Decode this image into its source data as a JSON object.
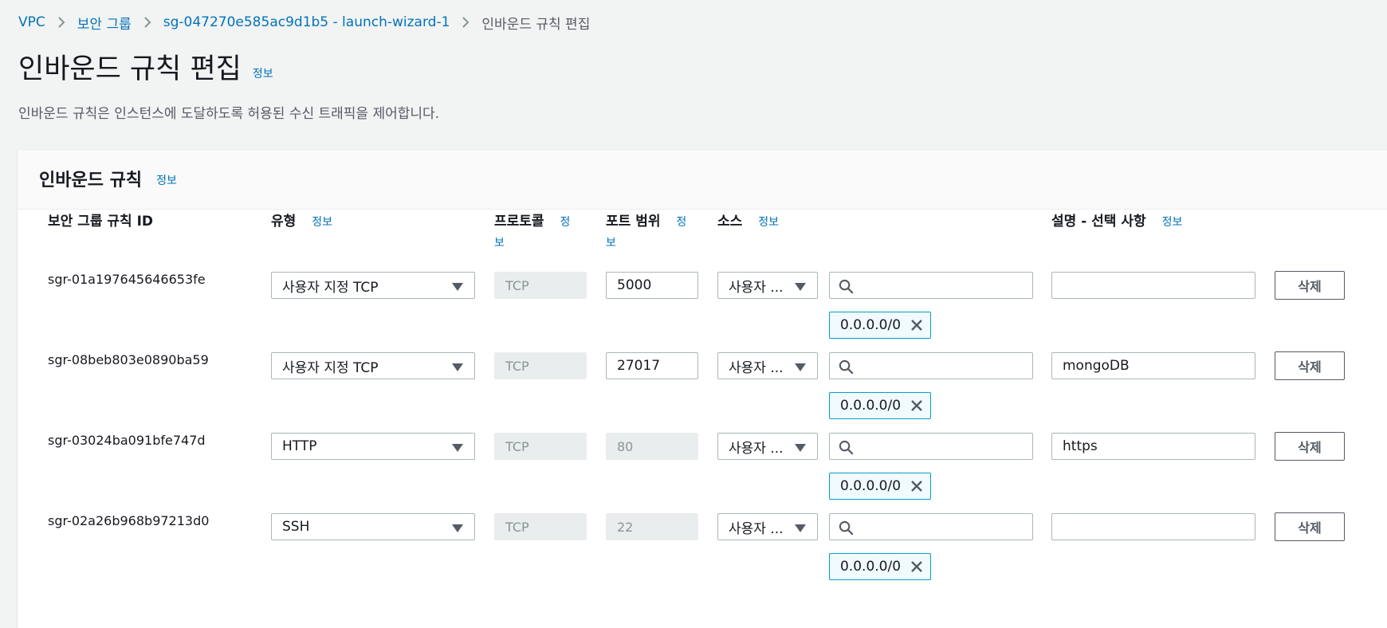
{
  "breadcrumb": {
    "items": [
      "VPC",
      "보안 그룹",
      "sg-047270e585ac9d1b5 - launch-wizard-1"
    ],
    "current": "인바운드 규칙 편집"
  },
  "page": {
    "title": "인바운드 규칙 편집",
    "info": "정보",
    "description": "인바운드 규칙은 인스턴스에 도달하도록 허용된 수신 트래픽을 제어합니다."
  },
  "panel": {
    "title": "인바운드 규칙",
    "info": "정보",
    "columns": {
      "id": "보안 그룹 규칙 ID",
      "type": "유형",
      "protocol": "프로토콜",
      "port": "포트 범위",
      "source": "소스",
      "desc": "설명 - 선택 사항"
    },
    "col_info": "정보",
    "protocol_info_line1": "정",
    "protocol_info_line2": "보",
    "port_info_line1": "정",
    "port_info_line2": "보"
  },
  "rules": [
    {
      "id": "sgr-01a197645646653fe",
      "type": "사용자 지정 TCP",
      "protocol": "TCP",
      "port": "5000",
      "source": "사용자 ...",
      "cidr": "0.0.0.0/0",
      "description": "",
      "delete": "삭제"
    },
    {
      "id": "sgr-08beb803e0890ba59",
      "type": "사용자 지정 TCP",
      "protocol": "TCP",
      "port": "27017",
      "source": "사용자 ...",
      "cidr": "0.0.0.0/0",
      "description": "mongoDB",
      "delete": "삭제"
    },
    {
      "id": "sgr-03024ba091bfe747d",
      "type": "HTTP",
      "protocol": "TCP",
      "port": "80",
      "source": "사용자 ...",
      "cidr": "0.0.0.0/0",
      "description": "https",
      "delete": "삭제"
    },
    {
      "id": "sgr-02a26b968b97213d0",
      "type": "SSH",
      "protocol": "TCP",
      "port": "22",
      "source": "사용자 ...",
      "cidr": "0.0.0.0/0",
      "description": "",
      "delete": "삭제"
    }
  ],
  "colors": {
    "link": "#0073bb",
    "token_border": "#00a1c9",
    "token_bg": "#f1faff",
    "background": "#f2f3f3"
  }
}
